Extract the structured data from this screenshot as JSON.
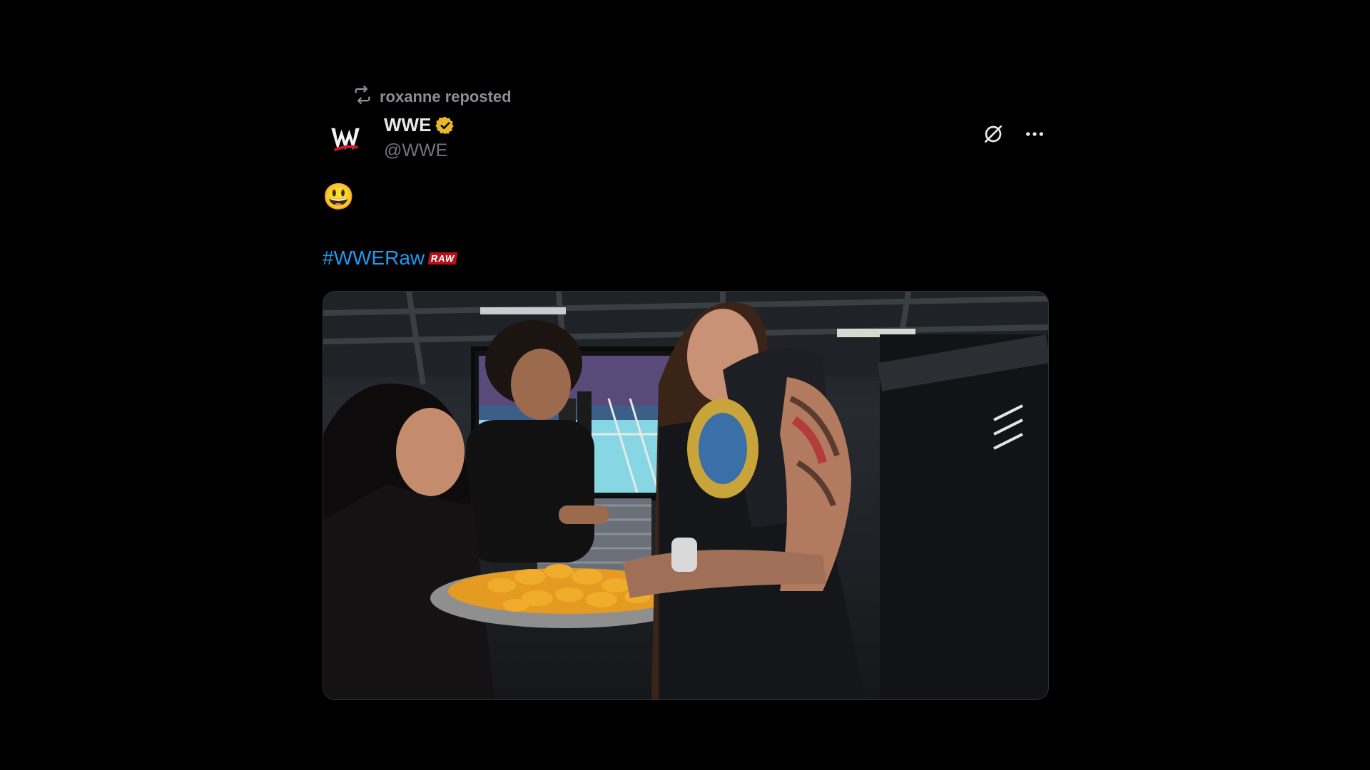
{
  "repost": {
    "text": "roxanne reposted",
    "icon": "repost-icon"
  },
  "author": {
    "display_name": "WWE",
    "handle": "@WWE",
    "avatar": "wwe-logo",
    "verified_icon": "verified-gold-badge-icon"
  },
  "actions": {
    "grok_icon": "grok-icon",
    "more_icon": "more-options-icon"
  },
  "content": {
    "emoji": "😃",
    "hashtag": "#WWERaw",
    "hashtag_logo": "RAW"
  },
  "media": {
    "type": "photo"
  },
  "colors": {
    "background": "#000000",
    "link": "#1d9bf0",
    "verified_gold": "#e8b829",
    "secondary_text": "#71767b",
    "raw_red": "#b5121b"
  }
}
